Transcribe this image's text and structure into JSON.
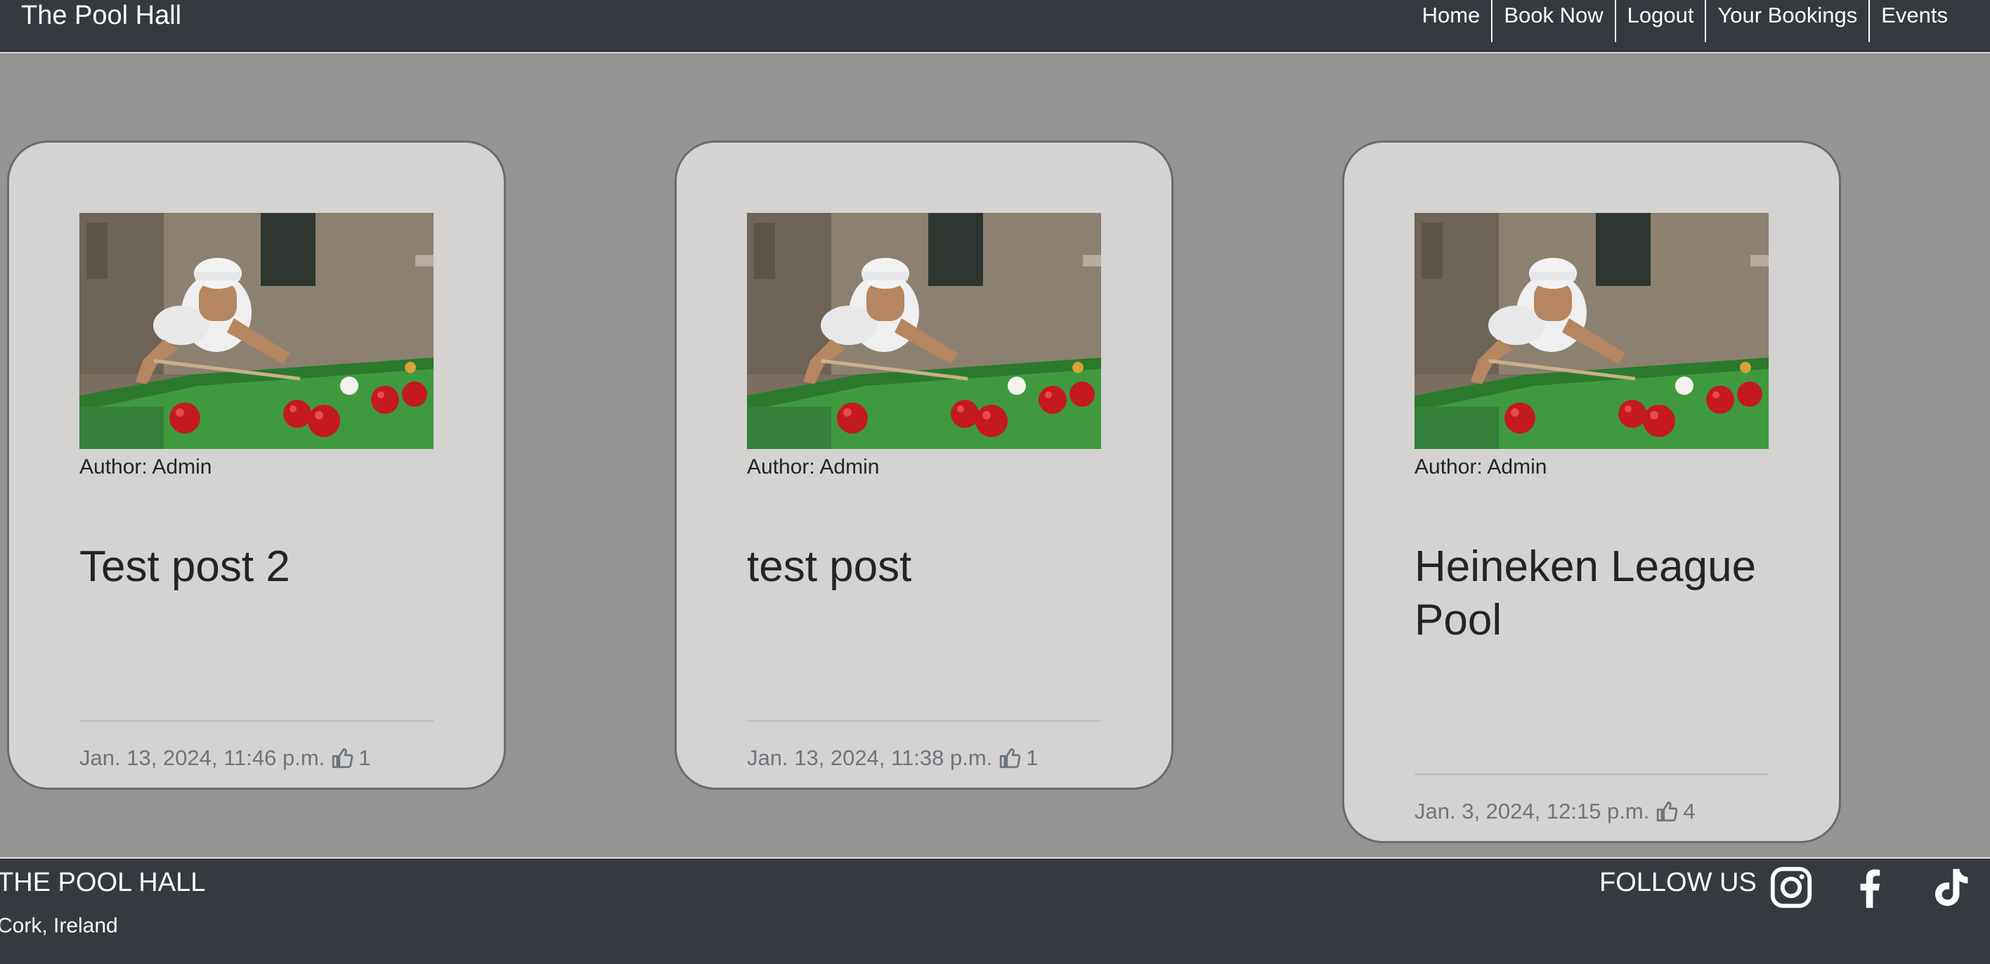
{
  "navbar": {
    "brand": "The Pool Hall",
    "links": [
      "Home",
      "Book Now",
      "Logout",
      "Your Bookings",
      "Events"
    ]
  },
  "posts": [
    {
      "author": "Author: Admin",
      "title": "Test post 2",
      "date": "Jan. 13, 2024, 11:46 p.m.",
      "likes": "1"
    },
    {
      "author": "Author: Admin",
      "title": "test post",
      "date": "Jan. 13, 2024, 11:38 p.m.",
      "likes": "1"
    },
    {
      "author": "Author: Admin",
      "title": "Heineken League Pool",
      "date": "Jan. 3, 2024, 12:15 p.m.",
      "likes": "4"
    }
  ],
  "footer": {
    "title": "THE POOL HALL",
    "location": "Cork, Ireland",
    "follow_label": "FOLLOW US",
    "social_icons": [
      "instagram-icon",
      "facebook-icon",
      "tiktok-icon"
    ]
  },
  "colors": {
    "navbar": "#343a40",
    "page_bg": "#949493",
    "card_bg": "#d4d3d2",
    "card_border": "#6b6a6e",
    "meta_text": "#6c757d"
  }
}
